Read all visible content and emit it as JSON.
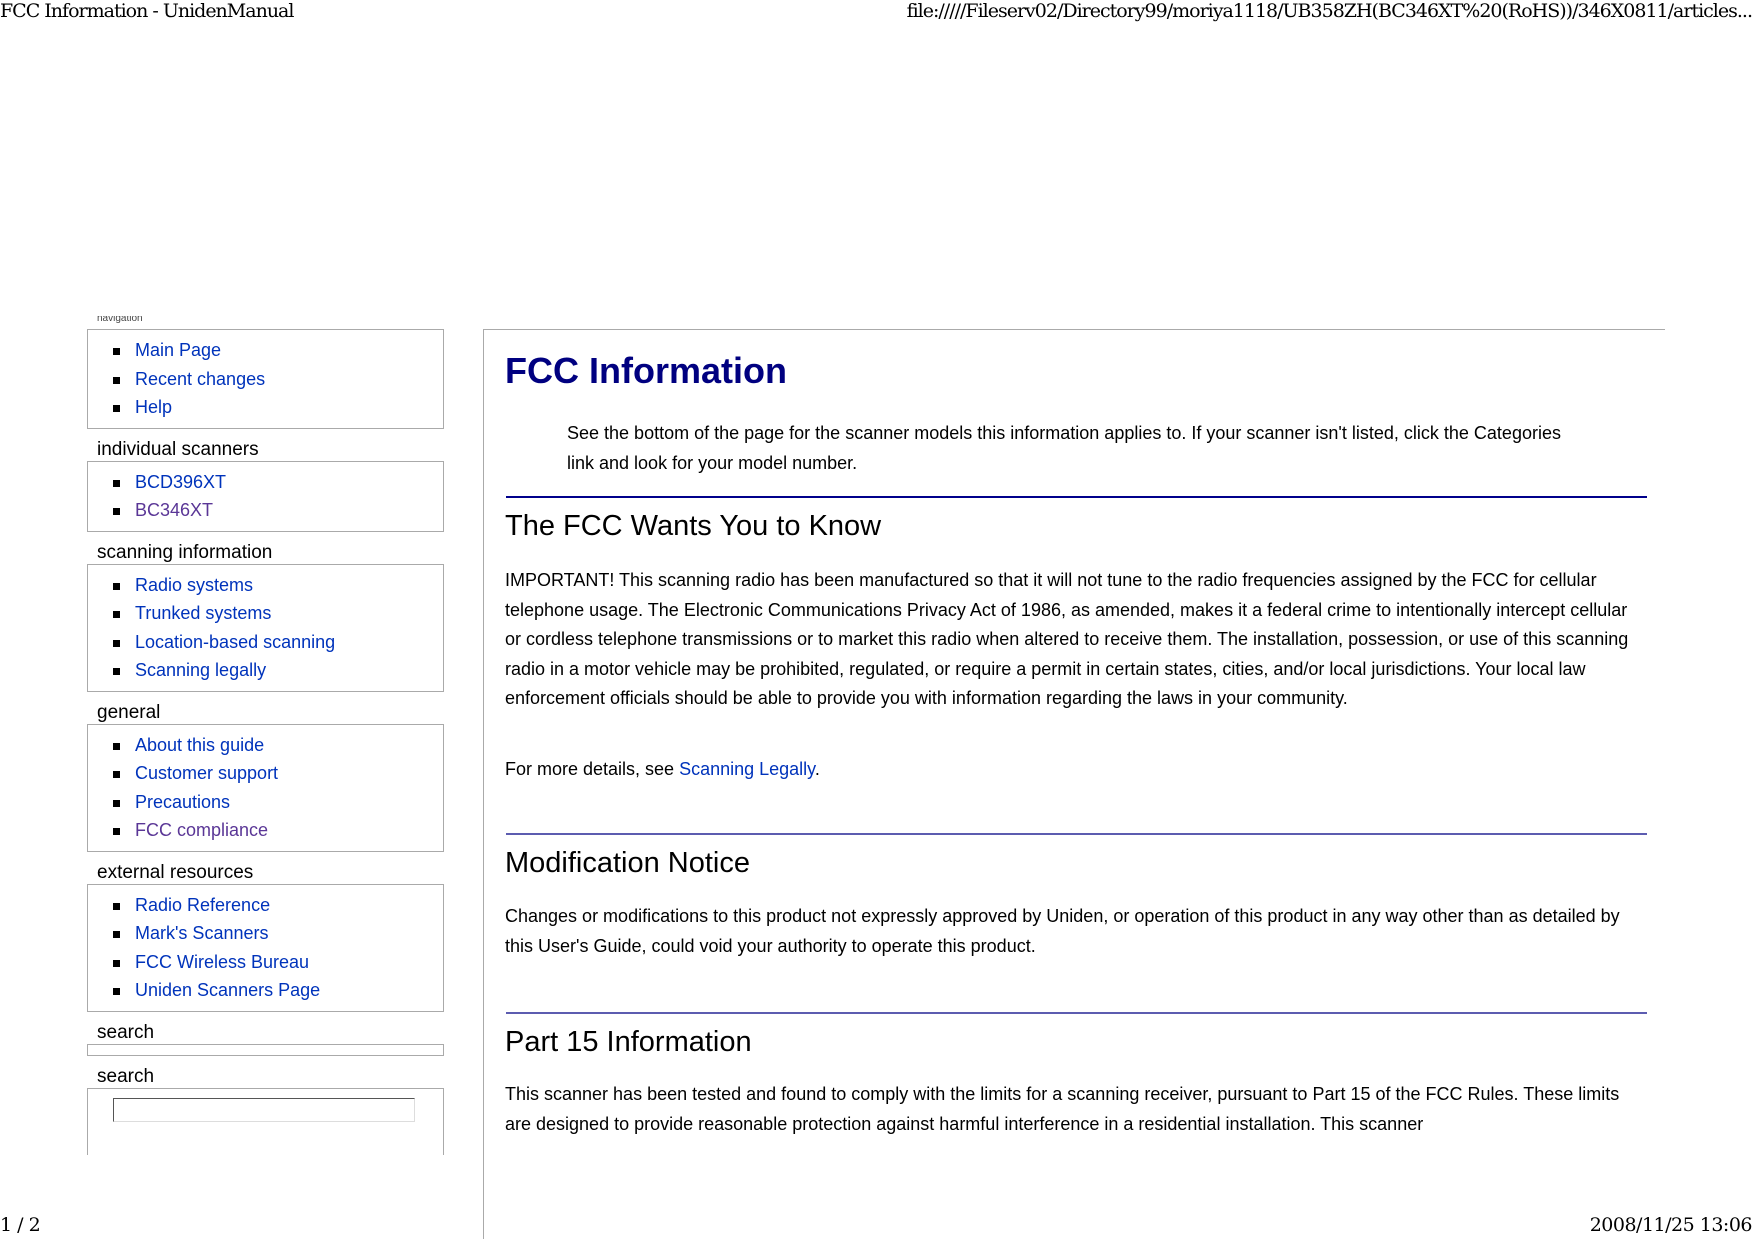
{
  "print_header": {
    "title": "FCC Information -  UnidenManual",
    "url": "file://///Fileserv02/Directory99/moriya1118/UB358ZH(BC346XT%20(RoHS))/346X0811/articles..."
  },
  "print_footer": {
    "page": "1 / 2",
    "datetime": "2008/11/25 13:06"
  },
  "sidebar": {
    "sections": [
      {
        "title": "navigation",
        "items": [
          {
            "label": "Main Page",
            "visited": false
          },
          {
            "label": "Recent changes",
            "visited": false
          },
          {
            "label": "Help",
            "visited": false
          }
        ]
      },
      {
        "title": "individual scanners",
        "items": [
          {
            "label": "BCD396XT",
            "visited": false
          },
          {
            "label": "BC346XT",
            "visited": true
          }
        ]
      },
      {
        "title": "scanning information",
        "items": [
          {
            "label": "Radio systems",
            "visited": false
          },
          {
            "label": "Trunked systems",
            "visited": false
          },
          {
            "label": "Location-based scanning",
            "visited": false
          },
          {
            "label": "Scanning legally",
            "visited": false
          }
        ]
      },
      {
        "title": "general",
        "items": [
          {
            "label": "About this guide",
            "visited": false
          },
          {
            "label": "Customer support",
            "visited": false
          },
          {
            "label": "Precautions",
            "visited": false
          },
          {
            "label": "FCC compliance",
            "visited": true
          }
        ]
      },
      {
        "title": "external resources",
        "items": [
          {
            "label": "Radio Reference",
            "visited": false
          },
          {
            "label": "Mark's Scanners",
            "visited": false
          },
          {
            "label": "FCC Wireless Bureau",
            "visited": false
          },
          {
            "label": "Uniden Scanners Page",
            "visited": false
          }
        ]
      }
    ],
    "search_1_title": "search",
    "search_2_title": "search",
    "search_value": ""
  },
  "content": {
    "title": "FCC Information",
    "intro": "See the bottom of the page for the scanner models this information applies to. If your scanner isn't listed, click the Categories link and look for your model number.",
    "sections": [
      {
        "heading": "The FCC Wants You to Know",
        "paragraph": "IMPORTANT! This scanning radio has been manufactured so that it will not tune to the radio frequencies assigned by the FCC for cellular telephone usage. The Electronic Communications Privacy Act of 1986, as amended, makes it a federal crime to intentionally intercept cellular or cordless telephone transmissions or to market this radio when altered to receive them. The installation, possession, or use of this scanning radio in a motor vehicle may be prohibited, regulated, or require a permit in certain states, cities, and/or local jurisdictions. Your local law enforcement officials should be able to provide you with information regarding the laws in your community.",
        "more_prefix": "For more details, see ",
        "more_link": "Scanning Legally",
        "more_suffix": "."
      },
      {
        "heading": "Modification Notice",
        "paragraph": "Changes or modifications to this product not expressly approved by Uniden, or operation of this product in any way other than as detailed by this User's Guide, could void your authority to operate this product."
      },
      {
        "heading": "Part 15 Information",
        "paragraph": "This scanner has been tested and found to comply with the limits for a scanning receiver, pursuant to Part 15 of the FCC Rules. These limits are designed to provide reasonable protection against harmful interference in a residential installation. This scanner"
      }
    ]
  },
  "colors": {
    "link": "#0033bb",
    "visited_link": "#5a3696",
    "title": "#000080",
    "section_rule": "#00008b"
  }
}
